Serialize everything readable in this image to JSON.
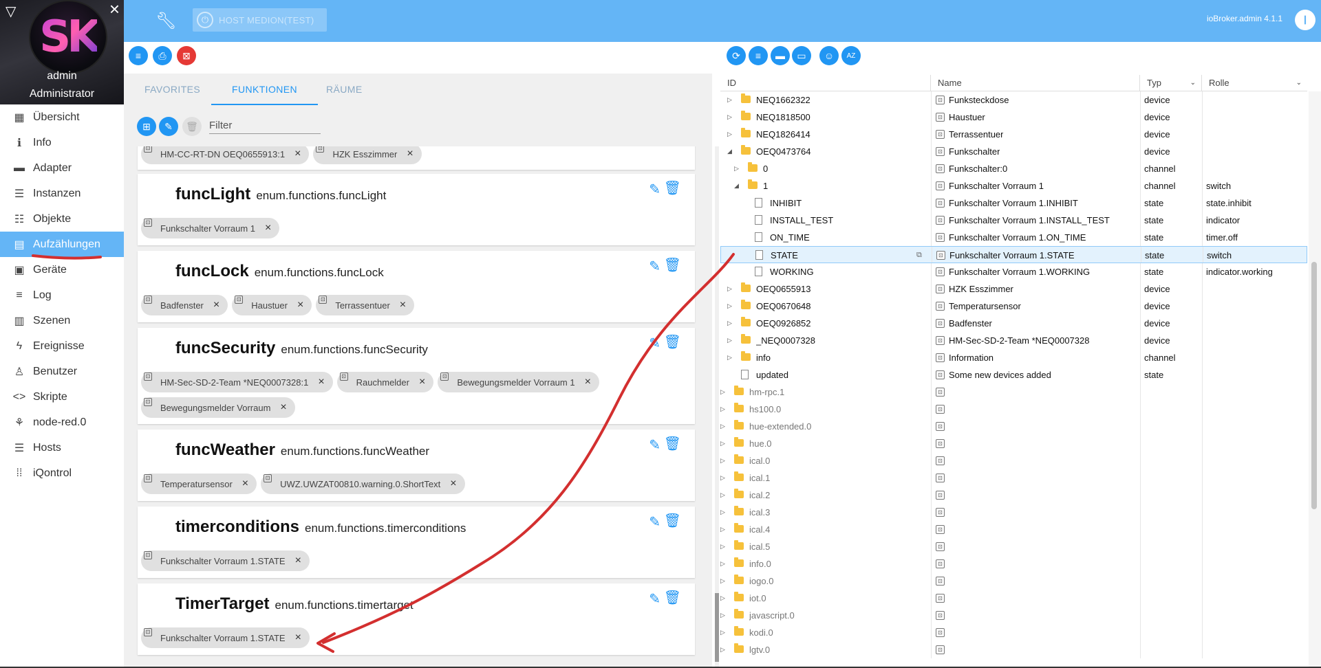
{
  "sidebar": {
    "user": "admin",
    "role": "Administrator",
    "avatar_initials": "SK",
    "items": [
      {
        "label": "Übersicht",
        "icon": "grid-icon",
        "glyph": "▦"
      },
      {
        "label": "Info",
        "icon": "info-icon",
        "glyph": "ℹ"
      },
      {
        "label": "Adapter",
        "icon": "store-icon",
        "glyph": "▬"
      },
      {
        "label": "Instanzen",
        "icon": "instances-icon",
        "glyph": "☰"
      },
      {
        "label": "Objekte",
        "icon": "list-icon",
        "glyph": "☷"
      },
      {
        "label": "Aufzählungen",
        "icon": "enum-icon",
        "glyph": "▤"
      },
      {
        "label": "Geräte",
        "icon": "devices-icon",
        "glyph": "▣"
      },
      {
        "label": "Log",
        "icon": "log-icon",
        "glyph": "≡"
      },
      {
        "label": "Szenen",
        "icon": "scenes-icon",
        "glyph": "▥"
      },
      {
        "label": "Ereignisse",
        "icon": "bolt-icon",
        "glyph": "ϟ"
      },
      {
        "label": "Benutzer",
        "icon": "user-icon",
        "glyph": "♙"
      },
      {
        "label": "Skripte",
        "icon": "code-icon",
        "glyph": "<>"
      },
      {
        "label": "node-red.0",
        "icon": "node-red-icon",
        "glyph": "⚘"
      },
      {
        "label": "Hosts",
        "icon": "hosts-icon",
        "glyph": "☰"
      },
      {
        "label": "iQontrol",
        "icon": "iqontrol-icon",
        "glyph": "⁞⁞"
      }
    ]
  },
  "topbar": {
    "host": "HOST MEDION(TEST)",
    "version": "ioBroker.admin 4.1.1"
  },
  "tabs": [
    {
      "label": "FAVORITES"
    },
    {
      "label": "FUNKTIONEN"
    },
    {
      "label": "RÄUME"
    }
  ],
  "filter": {
    "placeholder": "Filter"
  },
  "enum_cards": {
    "top_partial": {
      "chips": [
        "HM-CC-RT-DN OEQ0655913:1",
        "HZK Esszimmer"
      ]
    },
    "funcLight": {
      "title": "funcLight",
      "id": "enum.functions.funcLight",
      "chips": [
        "Funkschalter Vorraum 1"
      ]
    },
    "funcLock": {
      "title": "funcLock",
      "id": "enum.functions.funcLock",
      "chips": [
        "Badfenster",
        "Haustuer",
        "Terrassentuer"
      ]
    },
    "funcSecurity": {
      "title": "funcSecurity",
      "id": "enum.functions.funcSecurity",
      "chips": [
        "HM-Sec-SD-2-Team *NEQ0007328:1",
        "Rauchmelder",
        "Bewegungsmelder Vorraum 1"
      ],
      "chips2": [
        "Bewegungsmelder Vorraum"
      ]
    },
    "funcWeather": {
      "title": "funcWeather",
      "id": "enum.functions.funcWeather",
      "chips": [
        "Temperatursensor",
        "UWZ.UWZAT00810.warning.0.ShortText"
      ]
    },
    "timerconditions": {
      "title": "timerconditions",
      "id": "enum.functions.timerconditions",
      "chips": [
        "Funkschalter Vorraum 1.STATE"
      ]
    },
    "TimerTarget": {
      "title": "TimerTarget",
      "id": "enum.functions.timertarget",
      "chips": [
        "Funkschalter Vorraum 1.STATE"
      ]
    }
  },
  "tree": {
    "columns": {
      "id": "ID",
      "name": "Name",
      "type": "Typ",
      "role": "Rolle"
    },
    "rows": [
      {
        "id": "NEQ1662322",
        "name": "Funksteckdose",
        "type": "device",
        "role": ""
      },
      {
        "id": "NEQ1818500",
        "name": "Haustuer",
        "type": "device",
        "role": ""
      },
      {
        "id": "NEQ1826414",
        "name": "Terrassentuer",
        "type": "device",
        "role": ""
      },
      {
        "id": "OEQ0473764",
        "name": "Funkschalter",
        "type": "device",
        "role": ""
      },
      {
        "id": "0",
        "name": "Funkschalter:0",
        "type": "channel",
        "role": ""
      },
      {
        "id": "1",
        "name": "Funkschalter Vorraum 1",
        "type": "channel",
        "role": "switch"
      },
      {
        "id": "INHIBIT",
        "name": "Funkschalter Vorraum 1.INHIBIT",
        "type": "state",
        "role": "state.inhibit"
      },
      {
        "id": "INSTALL_TEST",
        "name": "Funkschalter Vorraum 1.INSTALL_TEST",
        "type": "state",
        "role": "indicator"
      },
      {
        "id": "ON_TIME",
        "name": "Funkschalter Vorraum 1.ON_TIME",
        "type": "state",
        "role": "timer.off"
      },
      {
        "id": "STATE",
        "name": "Funkschalter Vorraum 1.STATE",
        "type": "state",
        "role": "switch"
      },
      {
        "id": "WORKING",
        "name": "Funkschalter Vorraum 1.WORKING",
        "type": "state",
        "role": "indicator.working"
      },
      {
        "id": "OEQ0655913",
        "name": "HZK Esszimmer",
        "type": "device",
        "role": ""
      },
      {
        "id": "OEQ0670648",
        "name": "Temperatursensor",
        "type": "device",
        "role": ""
      },
      {
        "id": "OEQ0926852",
        "name": "Badfenster",
        "type": "device",
        "role": ""
      },
      {
        "id": "_NEQ0007328",
        "name": "HM-Sec-SD-2-Team *NEQ0007328",
        "type": "device",
        "role": ""
      },
      {
        "id": "info",
        "name": "Information",
        "type": "channel",
        "role": ""
      },
      {
        "id": "updated",
        "name": "Some new devices added",
        "type": "state",
        "role": ""
      },
      {
        "id": "hm-rpc.1",
        "name": "",
        "type": "",
        "role": ""
      },
      {
        "id": "hs100.0",
        "name": "",
        "type": "",
        "role": ""
      },
      {
        "id": "hue-extended.0",
        "name": "",
        "type": "",
        "role": ""
      },
      {
        "id": "hue.0",
        "name": "",
        "type": "",
        "role": ""
      },
      {
        "id": "ical.0",
        "name": "",
        "type": "",
        "role": ""
      },
      {
        "id": "ical.1",
        "name": "",
        "type": "",
        "role": ""
      },
      {
        "id": "ical.2",
        "name": "",
        "type": "",
        "role": ""
      },
      {
        "id": "ical.3",
        "name": "",
        "type": "",
        "role": ""
      },
      {
        "id": "ical.4",
        "name": "",
        "type": "",
        "role": ""
      },
      {
        "id": "ical.5",
        "name": "",
        "type": "",
        "role": ""
      },
      {
        "id": "info.0",
        "name": "",
        "type": "",
        "role": ""
      },
      {
        "id": "iogo.0",
        "name": "",
        "type": "",
        "role": ""
      },
      {
        "id": "iot.0",
        "name": "",
        "type": "",
        "role": ""
      },
      {
        "id": "javascript.0",
        "name": "",
        "type": "",
        "role": ""
      },
      {
        "id": "kodi.0",
        "name": "",
        "type": "",
        "role": ""
      },
      {
        "id": "lgtv.0",
        "name": "",
        "type": "",
        "role": ""
      }
    ]
  },
  "colors": {
    "accent": "#64b5f6",
    "primary": "#2196f3",
    "danger": "#e53935",
    "annotation": "#d32f2f"
  }
}
